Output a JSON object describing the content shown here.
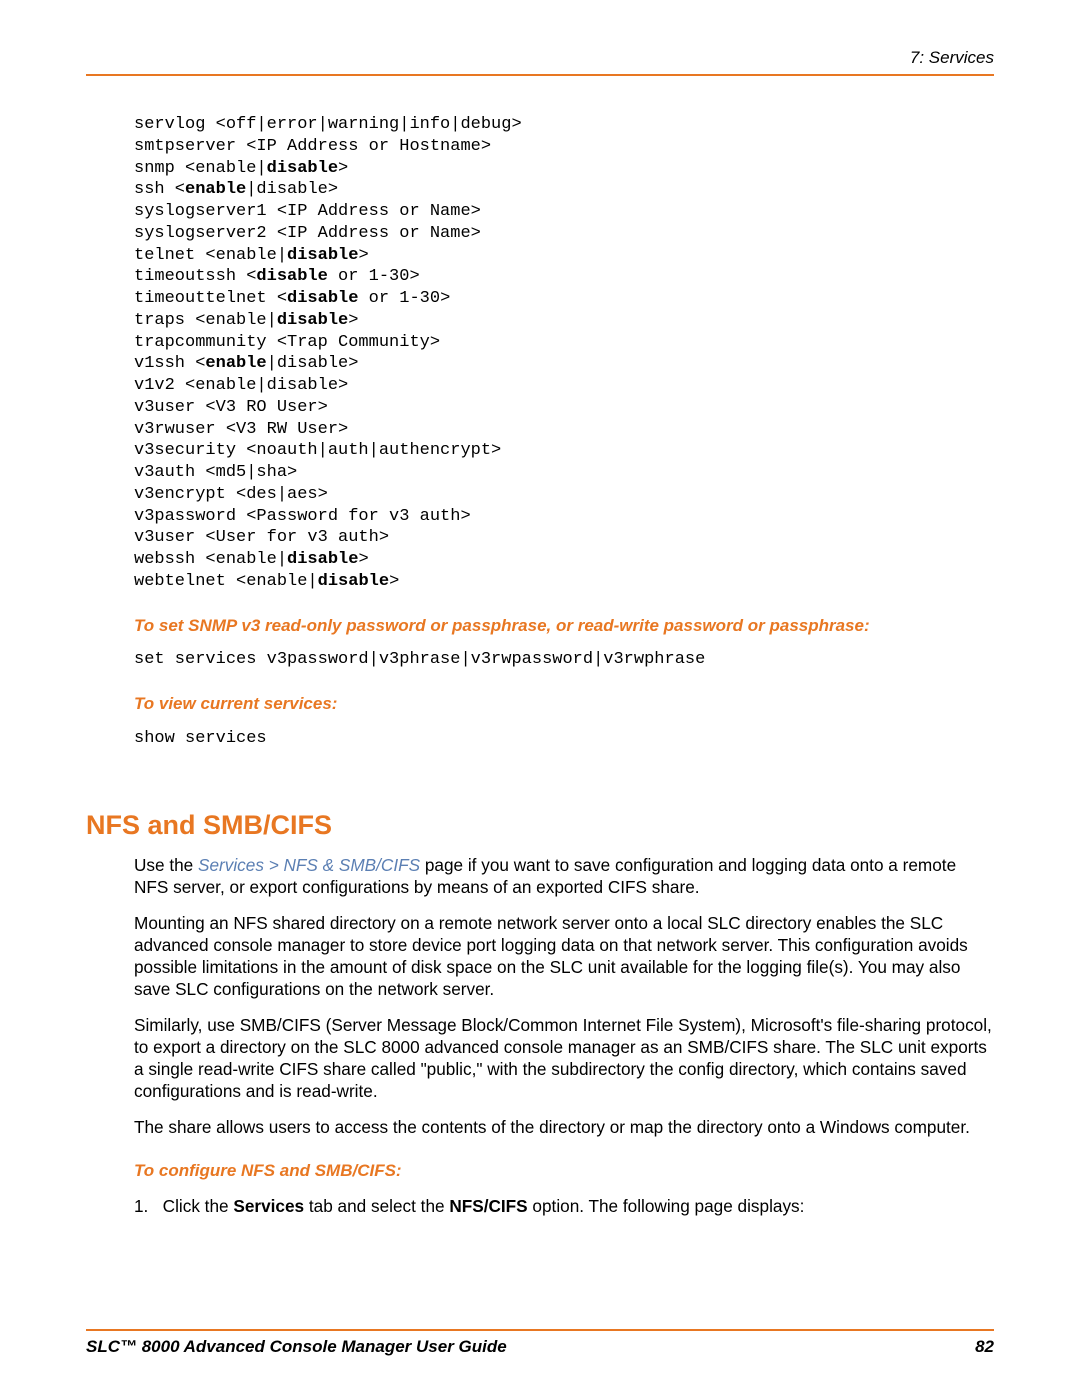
{
  "header": {
    "chapter": "7: Services"
  },
  "cmd": {
    "l1": "servlog <off|error|warning|info|debug>",
    "l2": "smtpserver <IP Address or Hostname>",
    "l3a": "snmp <enable|",
    "l3b": "disable",
    "l3c": ">",
    "l4a": "ssh <",
    "l4b": "enable",
    "l4c": "|disable>",
    "l5": "syslogserver1 <IP Address or Name>",
    "l6": "syslogserver2 <IP Address or Name>",
    "l7a": "telnet <enable|",
    "l7b": "disable",
    "l7c": ">",
    "l8a": "timeoutssh <",
    "l8b": "disable",
    "l8c": " or 1-30>",
    "l9a": "timeouttelnet <",
    "l9b": "disable",
    "l9c": " or 1-30>",
    "l10a": "traps <enable|",
    "l10b": "disable",
    "l10c": ">",
    "l11": "trapcommunity <Trap Community>",
    "l12a": "v1ssh <",
    "l12b": "enable",
    "l12c": "|disable>",
    "l13": "v1v2 <enable|disable>",
    "l14": "v3user <V3 RO User>",
    "l15": "v3rwuser <V3 RW User>",
    "l16": "v3security <noauth|auth|authencrypt>",
    "l17": "v3auth <md5|sha>",
    "l18": "v3encrypt <des|aes>",
    "l19": "v3password <Password for v3 auth>",
    "l20": "v3user <User for v3 auth>",
    "l21a": "webssh <enable|",
    "l21b": "disable",
    "l21c": ">",
    "l22a": "webtelnet <enable|",
    "l22b": "disable",
    "l22c": ">"
  },
  "heads": {
    "h1": "To set SNMP v3 read-only password or passphrase, or read-write password or passphrase:",
    "h2": "To view current services:",
    "h3": "To configure NFS and SMB/CIFS:"
  },
  "cmd2": "set services v3password|v3phrase|v3rwpassword|v3rwphrase",
  "cmd3": "show services",
  "section": {
    "title": "NFS and SMB/CIFS"
  },
  "body": {
    "p1a": "Use the ",
    "p1link": "Services > NFS & SMB/CIFS",
    "p1b": " page if you want to save configuration and logging data onto a remote NFS server, or export configurations by means of an exported CIFS share.",
    "p2": "Mounting an NFS shared directory on a remote network server onto a local SLC directory enables the SLC advanced console manager to store device port logging data on that network server. This configuration avoids possible limitations in the amount of disk space on the SLC unit available for the logging file(s). You may also save SLC configurations on the network server.",
    "p3": "Similarly, use SMB/CIFS (Server Message Block/Common Internet File System), Microsoft's file-sharing protocol, to export a directory on the SLC 8000 advanced console manager as an SMB/CIFS share. The SLC unit exports a single read-write CIFS share called \"public,\" with the subdirectory the config directory, which contains saved configurations and is read-write.",
    "p4": "The share allows users to access the contents of the directory or map the directory onto a Windows computer."
  },
  "step": {
    "num": "1.",
    "a": "Click the ",
    "b1": "Services",
    "c": " tab and select the ",
    "b2": "NFS/CIFS",
    "d": " option. The following page displays:"
  },
  "footer": {
    "title": "SLC™ 8000 Advanced Console Manager User Guide",
    "page": "82"
  }
}
